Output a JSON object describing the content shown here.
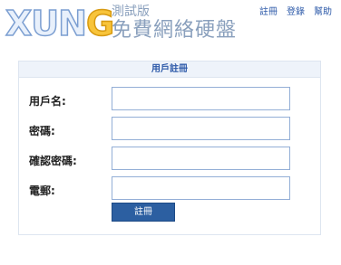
{
  "header": {
    "logo_word_prefix": "XUN",
    "logo_word_g": "G",
    "logo_beta": "測試版",
    "logo_name": "免費網絡硬盤"
  },
  "topnav": {
    "register": "註冊",
    "login": "登錄",
    "help": "幫助"
  },
  "form": {
    "title": "用戶註冊",
    "fields": [
      {
        "label": "用戶名:",
        "value": "",
        "placeholder": ""
      },
      {
        "label": "密碼:",
        "value": "",
        "placeholder": ""
      },
      {
        "label": "確認密碼:",
        "value": "",
        "placeholder": ""
      },
      {
        "label": "電郵:",
        "value": "",
        "placeholder": ""
      }
    ],
    "submit_label": "註冊"
  },
  "colors": {
    "accent": "#2c5fa1",
    "link": "#2b58a8",
    "panel_border": "#dde5f0",
    "input_border": "#93aed6",
    "logo_g": "#f8c43a"
  }
}
